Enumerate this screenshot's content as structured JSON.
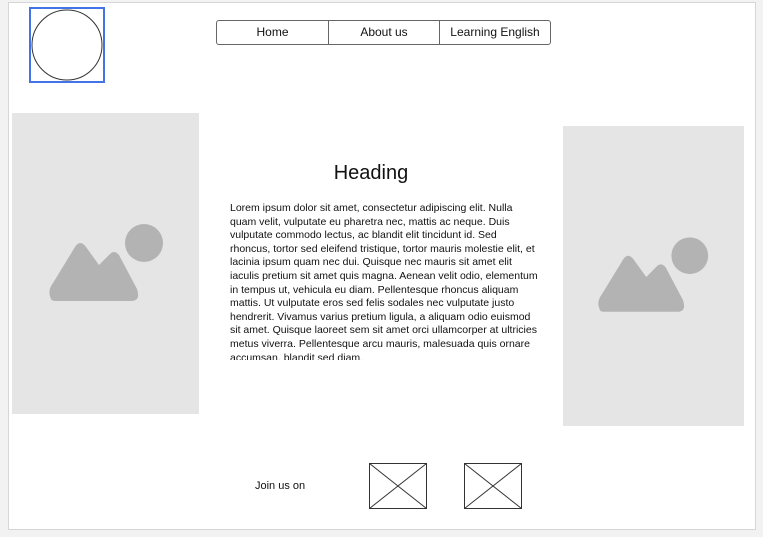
{
  "nav": {
    "items": [
      {
        "label": "Home"
      },
      {
        "label": "About us"
      },
      {
        "label": "Learning English"
      }
    ]
  },
  "main": {
    "heading": "Heading",
    "body": "Lorem ipsum dolor sit amet, consectetur adipiscing elit. Nulla quam velit, vulputate eu pharetra nec, mattis ac neque. Duis vulputate commodo lectus, ac blandit elit tincidunt id. Sed rhoncus, tortor sed eleifend tristique, tortor mauris molestie elit, et lacinia ipsum quam nec dui. Quisque nec mauris sit amet elit iaculis pretium sit amet quis magna. Aenean velit odio, elementum in tempus ut, vehicula eu diam. Pellentesque rhoncus aliquam mattis. Ut vulputate eros sed felis sodales nec vulputate justo hendrerit. Vivamus varius pretium ligula, a aliquam odio euismod sit amet. Quisque laoreet sem sit amet orci ullamcorper at ultricies metus viverra. Pellentesque arcu mauris, malesuada quis ornare accumsan, blandit sed diam."
  },
  "footer": {
    "join_label": "Join us on"
  },
  "colors": {
    "selection_accent": "#4472e8",
    "placeholder_bg": "#e5e5e5",
    "placeholder_icon": "#b3b3b3"
  },
  "icons": {
    "logo": "circle-logo-icon",
    "image_placeholder": "image-placeholder-icon",
    "social": "crossed-box-placeholder-icon"
  }
}
